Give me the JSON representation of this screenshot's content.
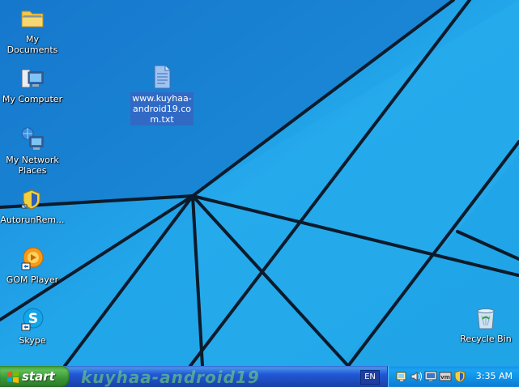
{
  "desktop": {
    "icons": [
      {
        "label": "My Documents",
        "icon": "folder-documents-icon"
      },
      {
        "label": "My Computer",
        "icon": "computer-icon"
      },
      {
        "label": "My Network Places",
        "icon": "network-places-icon"
      },
      {
        "label": "AutorunRem...",
        "icon": "autorun-remover-icon"
      },
      {
        "label": "GOM Player",
        "icon": "gom-player-icon"
      },
      {
        "label": "Skype",
        "icon": "skype-icon"
      },
      {
        "label": "Recycle Bin",
        "icon": "recycle-bin-icon"
      }
    ],
    "selected_file": {
      "label": "www.kuyhaa-android19.com.txt",
      "icon": "text-file-icon"
    },
    "colors": {
      "wallpaper": "#1fa4e6",
      "wallpaper_dark": "#1478c8",
      "stripe": "#0b1b2b"
    }
  },
  "taskbar": {
    "start_label": "start",
    "watermark": "kuyhaa-android19",
    "language": "EN",
    "tray_icons": [
      "network-connections-icon",
      "volume-icon",
      "display-icon",
      "vmware-tools-icon",
      "security-shield-icon"
    ],
    "clock": "3:35 AM",
    "colors": {
      "taskbar": "#2157d7",
      "start": "#389534",
      "tray": "#0f8ae1"
    }
  }
}
